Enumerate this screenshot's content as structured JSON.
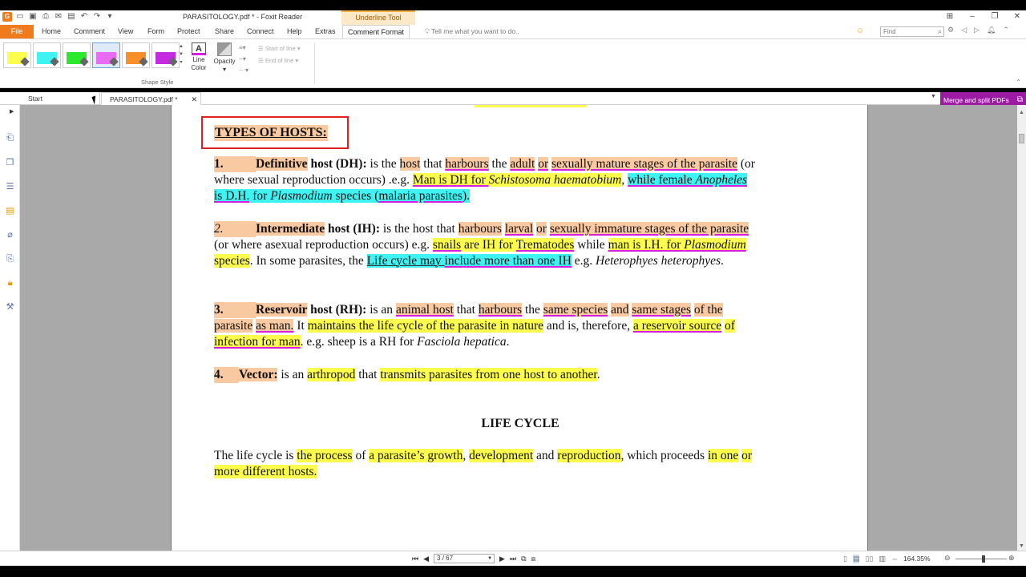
{
  "window": {
    "title": "PARASITOLOGY.pdf * - Foxit Reader",
    "context_tab": "Underline Tool"
  },
  "menu": {
    "file": "File",
    "items": [
      "Home",
      "Comment",
      "View",
      "Form",
      "Protect",
      "Share",
      "Connect",
      "Help",
      "Extras",
      "Comment Format"
    ],
    "tellme": "Tell me what you want to do..",
    "find_placeholder": "Find"
  },
  "ribbon": {
    "swatch_colors": [
      "#fdfd4d",
      "#3ff3f3",
      "#2ee82e",
      "#e86bf1",
      "#f7902a",
      "#c42ae0"
    ],
    "group_label": "Shape Style",
    "line_color_label_1": "Line",
    "line_color_label_2": "Color",
    "opacity_label": "Opacity",
    "start_of_line": "Start of line",
    "end_of_line": "End of line"
  },
  "tabs": {
    "start": "Start",
    "document": "PARASITOLOGY.pdf *"
  },
  "merge": {
    "label": "Merge and split PDFs"
  },
  "doc": {
    "heading": "TYPES OF HOSTS:",
    "p1": {
      "num": "1.",
      "term": "Definitive",
      "term2": " host (DH):",
      "t1": " is the ",
      "h1": "host",
      "t2": " that ",
      "h2": "harbours",
      "t3": " the ",
      "h3": "adult",
      "t4": " ",
      "h4": "or",
      "t5": " ",
      "h5": "sexually mature stages of the parasite",
      "t6": " (or",
      "line2a": "where sexual reproduction occurs) .e.g. ",
      "h6": "Man is DH for ",
      "h6i": "Schistosoma haematobium",
      "t7": ", ",
      "h7": "while female ",
      "h7i": "Anopheles",
      "line3a": "is D.H.",
      "line3b": " for ",
      "line3i": "Plasmodium",
      "line3c": " species (",
      "line3d": "malaria parasites",
      "line3e": ")."
    },
    "p2": {
      "num": "2.",
      "term": "Intermediate",
      "term2": " host (IH):",
      "t1": " is the host that ",
      "h1": "harbours",
      "t2": " ",
      "h2": "larval",
      "t3": " ",
      "h3": "or",
      "t4": " ",
      "h4": "sexually immature stages of the parasite",
      "line2a": "(or where asexual reproduction occurs) e.g. ",
      "h5": "snails",
      "h5b": " are IH for ",
      "h5c": "Trematodes",
      "t5": " while ",
      "h6": "man is I.H. for ",
      "h6i": "Plasmodium",
      "line3a": "species",
      "line3b": ". In some parasites, the ",
      "h7": "Life cycle may ",
      "h7b": "include more than one IH",
      "line3c": " e.g.  ",
      "line3i": "Heterophyes heterophyes",
      "line3d": "."
    },
    "p3": {
      "num": "3.",
      "term": "Reservoir",
      "term2": " host (RH):",
      "t1": " is an ",
      "h1": "animal host",
      "t2": " that ",
      "h2": "harbours",
      "t3": " the ",
      "h3": "same species",
      "t4": " ",
      "h4": "and",
      "t5": " ",
      "h5": "same stages",
      "t6": " ",
      "h6": "of the",
      "line2a": "parasite",
      "line2b": " ",
      "line2c": "as man.",
      "line2d": " It ",
      "h7": "maintains the life cycle of the parasite in nature",
      "t7": " and is, therefore, ",
      "h8": "a reservoir source",
      "t8": " ",
      "h9": "of",
      "line3a": "infection for man",
      "line3b": ". e.g. sheep is a RH for ",
      "line3i": "Fasciola hepatica",
      "line3c": "."
    },
    "p4": {
      "num": "4.",
      "term": "Vector:",
      "t1": " is an ",
      "h1": "arthropod",
      "t2": " that ",
      "h2": "transmits parasites from one host to another",
      "t3": "."
    },
    "life_cycle_heading": "LIFE CYCLE",
    "p5": {
      "t1": "The life cycle is ",
      "h1": "the process",
      "t2": " of ",
      "h2": "a parasite’s growth",
      "t3": ", ",
      "h3": "development",
      "t4": " and ",
      "h4": "reproduction",
      "t5": ", which proceeds ",
      "h5": "in one",
      "t6": " ",
      "h6": "or",
      "line2": "more different hosts."
    }
  },
  "status": {
    "page": "3 / 67",
    "zoom": "164.35%"
  }
}
